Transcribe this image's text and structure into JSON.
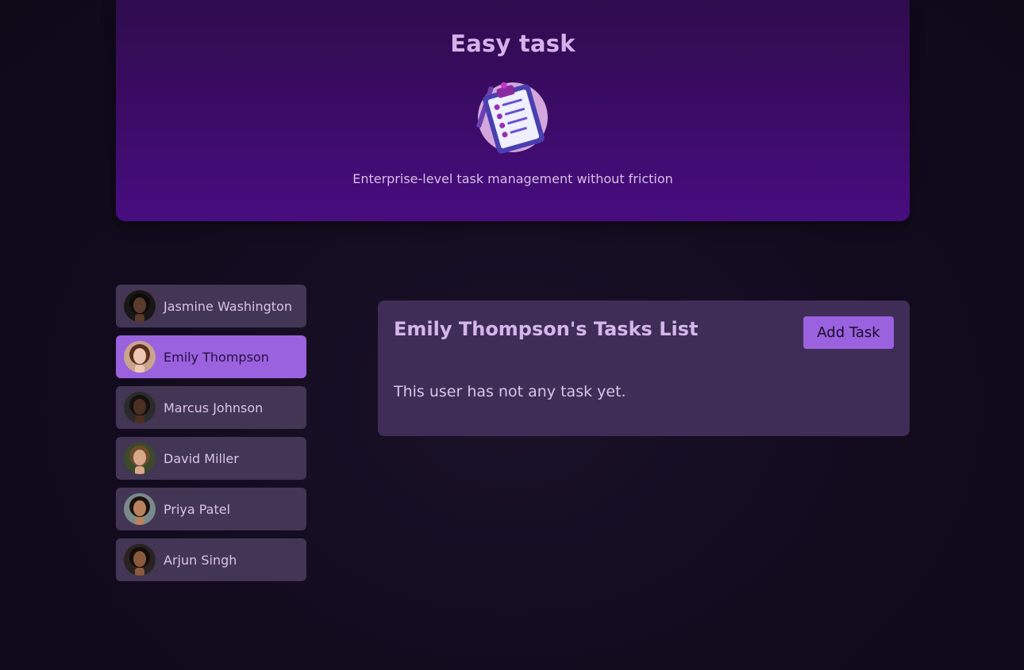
{
  "header": {
    "title": "Easy task",
    "tagline": "Enterprise-level task management without friction",
    "logo_icon": "clipboard-checklist-icon"
  },
  "users": [
    {
      "name": "Jasmine Washington",
      "active": false,
      "avatar_bg": "#1b1616",
      "face": "#5a3a2a",
      "hair": "#0d0a0a"
    },
    {
      "name": "Emily Thompson",
      "active": true,
      "avatar_bg": "#c9a48c",
      "face": "#eec7b0",
      "hair": "#5b2f20"
    },
    {
      "name": "Marcus Johnson",
      "active": false,
      "avatar_bg": "#2b2b2b",
      "face": "#4a2f22",
      "hair": "#151010"
    },
    {
      "name": "David Miller",
      "active": false,
      "avatar_bg": "#3a4a2a",
      "face": "#d8a98a",
      "hair": "#6b4a2a"
    },
    {
      "name": "Priya Patel",
      "active": false,
      "avatar_bg": "#7a8a8a",
      "face": "#b9825e",
      "hair": "#1a1210"
    },
    {
      "name": "Arjun Singh",
      "active": false,
      "avatar_bg": "#2a2220",
      "face": "#8a5a3c",
      "hair": "#120d0b"
    }
  ],
  "panel": {
    "title": "Emily Thompson's Tasks List",
    "add_label": "Add Task",
    "empty_message": "This user has not any task yet."
  },
  "colors": {
    "accent": "#9a62de",
    "card": "#433554",
    "panel": "#3f2d57",
    "background": "#120b1e"
  }
}
